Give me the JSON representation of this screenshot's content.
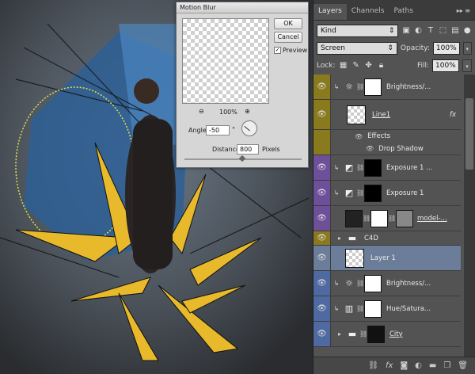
{
  "dialog": {
    "title": "Motion Blur",
    "ok": "OK",
    "cancel": "Cancel",
    "preview": "Preview",
    "zoom": "100%",
    "angle_label": "Angle:",
    "angle_value": "-50",
    "angle_unit": "°",
    "distance_label": "Distance:",
    "distance_value": "800",
    "distance_unit": "Pixels"
  },
  "panel": {
    "tabs": [
      "Layers",
      "Channels",
      "Paths"
    ],
    "filter_kind": "Kind",
    "blend_mode": "Screen",
    "opacity_label": "Opacity:",
    "opacity_value": "100%",
    "lock_label": "Lock:",
    "fill_label": "Fill:",
    "fill_value": "100%"
  },
  "layers": [
    {
      "name": "Brightness/...",
      "color": "#8a7a1e"
    },
    {
      "name": "Line1",
      "fx": "fx",
      "color": "#8a7a1e"
    },
    {
      "name": "Effects"
    },
    {
      "name": "Drop Shadow"
    },
    {
      "name": "Exposure 1 ...",
      "color": "#6e4f9a"
    },
    {
      "name": "Exposure 1",
      "color": "#6e4f9a"
    },
    {
      "name": "model-...",
      "color": "#6e4f9a"
    },
    {
      "name": "C4D",
      "color": "#8a7a1e"
    },
    {
      "name": "Layer 1",
      "selected": true
    },
    {
      "name": "Brightness/...",
      "color": "#4f6aa0"
    },
    {
      "name": "Hue/Satura...",
      "color": "#4f6aa0"
    },
    {
      "name": "City",
      "color": "#4f6aa0"
    }
  ]
}
